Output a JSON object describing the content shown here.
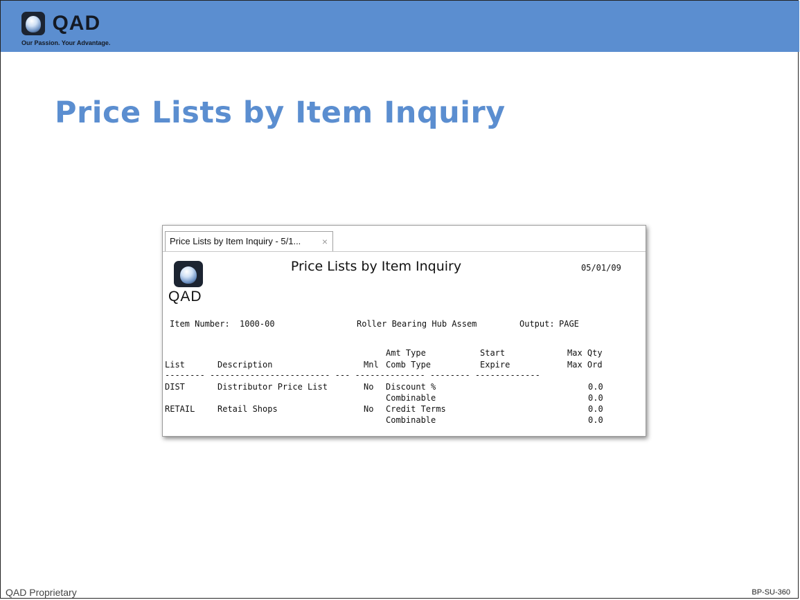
{
  "logo": {
    "text": "QAD",
    "tagline": "Our Passion. Your Advantage."
  },
  "slide_title": "Price Lists by Item Inquiry",
  "window": {
    "tab_label": "Price Lists by Item Inquiry - 5/1...",
    "tab_close": "×",
    "report": {
      "logo_text": "QAD",
      "title": "Price Lists by Item Inquiry",
      "date": "05/01/09",
      "item_label": "Item Number:",
      "item_number": "1000-00",
      "item_description": "Roller Bearing Hub Assem",
      "output_label": "Output:",
      "output_value": "PAGE",
      "headers": {
        "row1": [
          "",
          "",
          "",
          "Amt Type",
          "Start",
          "Max Qty"
        ],
        "row2": [
          "List",
          "Description",
          "Mnl",
          "Comb Type",
          "Expire",
          "Max Ord"
        ],
        "separator": "-------- ------------------------ --- -------------- -------- -------------"
      },
      "rows": [
        {
          "list": "DIST",
          "description": "Distributor Price List",
          "manual": "No",
          "amt_type": "Discount %",
          "comb_type": "Combinable",
          "start": "",
          "expire": "",
          "max_qty": "0.0",
          "max_ord": "0.0"
        },
        {
          "list": "RETAIL",
          "description": "Retail Shops",
          "manual": "No",
          "amt_type": "Credit Terms",
          "comb_type": "Combinable",
          "start": "",
          "expire": "",
          "max_qty": "0.0",
          "max_ord": "0.0"
        }
      ]
    }
  },
  "footer": {
    "left": "QAD Proprietary",
    "right": "BP-SU-360"
  },
  "colors": {
    "header_bar": "#5b8ed0",
    "title": "#5b8ed0",
    "logo_dark": "#1c2431"
  }
}
